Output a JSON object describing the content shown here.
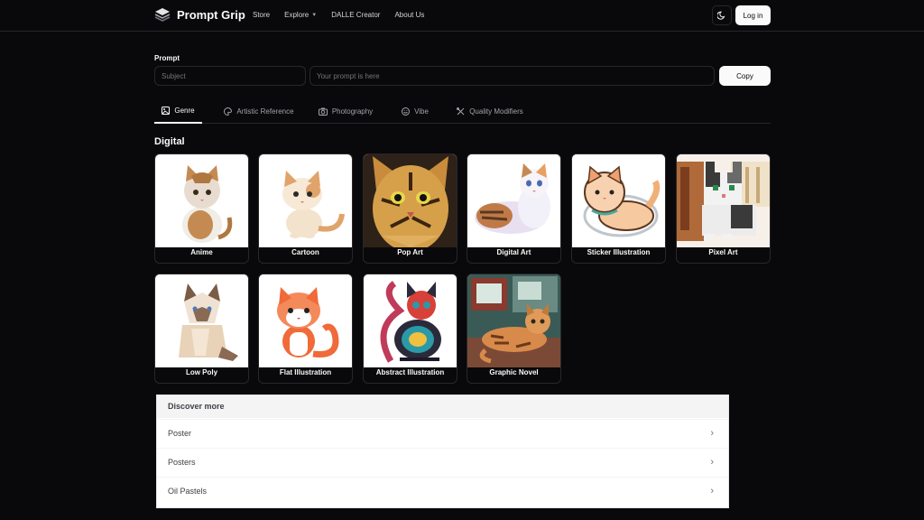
{
  "header": {
    "brand": "Prompt Grip",
    "nav": [
      {
        "label": "Store"
      },
      {
        "label": "Explore"
      },
      {
        "label": "DALLE Creator"
      },
      {
        "label": "About Us"
      }
    ],
    "login_label": "Log in"
  },
  "prompt": {
    "label": "Prompt",
    "subject_placeholder": "Subject",
    "prompt_placeholder": "Your prompt is here",
    "copy_label": "Copy"
  },
  "tabs": [
    {
      "label": "Genre",
      "icon": "image-icon",
      "active": true
    },
    {
      "label": "Artistic Reference",
      "icon": "palette-icon",
      "active": false
    },
    {
      "label": "Photography",
      "icon": "camera-icon",
      "active": false
    },
    {
      "label": "Vibe",
      "icon": "smile-icon",
      "active": false
    },
    {
      "label": "Quality Modifiers",
      "icon": "tools-icon",
      "active": false
    }
  ],
  "section": {
    "title": "Digital",
    "cards": [
      {
        "label": "Anime"
      },
      {
        "label": "Cartoon"
      },
      {
        "label": "Pop Art"
      },
      {
        "label": "Digital Art"
      },
      {
        "label": "Sticker Illustration"
      },
      {
        "label": "Pixel Art"
      },
      {
        "label": "Low Poly"
      },
      {
        "label": "Flat Illustration"
      },
      {
        "label": "Abstract Illustration"
      },
      {
        "label": "Graphic Novel"
      }
    ]
  },
  "discover": {
    "title": "Discover more",
    "items": [
      {
        "label": "Poster"
      },
      {
        "label": "Posters"
      },
      {
        "label": "Oil Pastels"
      }
    ]
  }
}
